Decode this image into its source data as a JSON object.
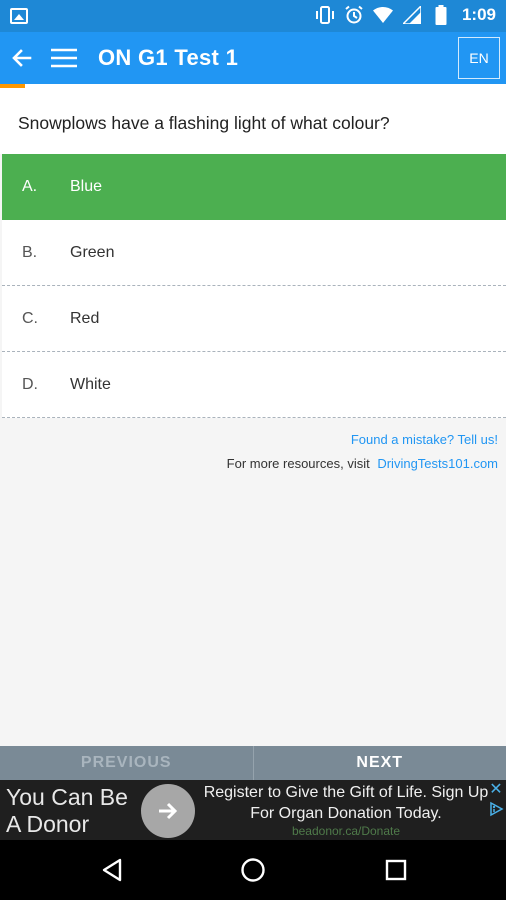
{
  "status_bar": {
    "time": "1:09",
    "icons": [
      "image-icon",
      "vibrate-icon",
      "alarm-icon",
      "wifi-icon",
      "signal-icon",
      "battery-icon"
    ]
  },
  "app_bar": {
    "title": "ON G1 Test 1",
    "language": "EN",
    "icons": [
      "back-arrow-icon",
      "menu-icon"
    ]
  },
  "progress": {
    "value_fraction": 0.05,
    "color": "#ff9800"
  },
  "question": {
    "text": "Snowplows have a flashing light of what colour?",
    "options": [
      {
        "letter": "A.",
        "text": "Blue",
        "selected": true
      },
      {
        "letter": "B.",
        "text": "Green",
        "selected": false
      },
      {
        "letter": "C.",
        "text": "Red",
        "selected": false
      },
      {
        "letter": "D.",
        "text": "White",
        "selected": false
      }
    ]
  },
  "links": {
    "mistake": "Found a mistake? Tell us!",
    "resources_prefix": "For more resources, visit",
    "resources_link": "DrivingTests101.com"
  },
  "nav_buttons": {
    "previous": "PREVIOUS",
    "next": "NEXT"
  },
  "ad": {
    "left_text_line1": "You Can Be",
    "left_text_line2": "A Donor",
    "headline": "Register to Give the Gift of Life. Sign Up For Organ Donation Today.",
    "url": "beadonor.ca/Donate"
  },
  "colors": {
    "status_bar": "#1e88d6",
    "app_bar": "#2196f3",
    "selected_option": "#4caf50",
    "link": "#2196f3",
    "nav_buttons_bg": "#7a8a96"
  }
}
